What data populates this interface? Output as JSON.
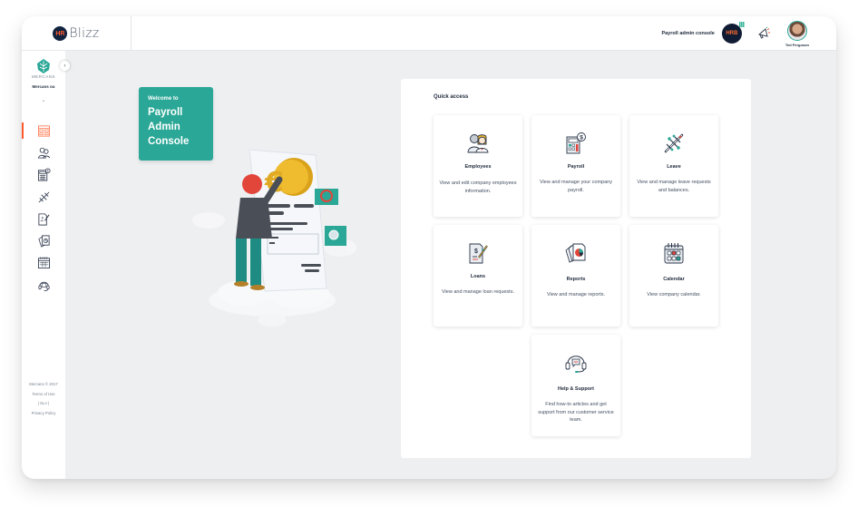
{
  "app": {
    "logo_badge": "HR",
    "name": "Blizz"
  },
  "header": {
    "console_label": "Payroll admin console",
    "company_logo_text": "HRB",
    "notifications_icon": "megaphone-icon",
    "user_name": "Ted Ferguson"
  },
  "sidebar": {
    "org_wordmark": "MERCANS",
    "org_name": "Mercans ou",
    "org_switch_icon": "chevron-down-icon",
    "collapse_icon": "chevron-right-icon",
    "items": [
      {
        "label": "Dashboard",
        "icon": "dashboard-icon",
        "active": true
      },
      {
        "label": "Employees",
        "icon": "employees-icon",
        "active": false
      },
      {
        "label": "Payroll",
        "icon": "payroll-calculator-icon",
        "active": false
      },
      {
        "label": "Leave",
        "icon": "airplane-icon",
        "active": false
      },
      {
        "label": "Loans",
        "icon": "loan-document-icon",
        "active": false
      },
      {
        "label": "Reports",
        "icon": "reports-icon",
        "active": false
      },
      {
        "label": "Calendar",
        "icon": "calendar-icon",
        "active": false
      },
      {
        "label": "Help & Support",
        "icon": "headset-icon",
        "active": false
      }
    ],
    "footer": {
      "copyright": "Mercans © 2017",
      "terms": "Terms of Use",
      "sla": "| SLA |",
      "privacy": "Privacy Policy"
    }
  },
  "welcome": {
    "small": "Welcome to",
    "title_line1": "Payroll",
    "title_line2": "Admin",
    "title_line3": "Console"
  },
  "quick_access": {
    "title": "Quick access",
    "tiles": [
      {
        "name": "Employees",
        "description": "View and edit company employees information.",
        "icon": "employees-icon"
      },
      {
        "name": "Payroll",
        "description": "View and manage your company payroll.",
        "icon": "payroll-calculator-icon"
      },
      {
        "name": "Leave",
        "description": "View and manage leave requests and balances.",
        "icon": "airplane-icon"
      },
      {
        "name": "Loans",
        "description": "View and manage loan requests.",
        "icon": "loan-document-icon"
      },
      {
        "name": "Reports",
        "description": "View and manage reports.",
        "icon": "reports-icon"
      },
      {
        "name": "Calendar",
        "description": "View company calendar.",
        "icon": "calendar-icon"
      },
      {
        "name": "Help & Support",
        "description": "Find how-to articles and get support from our customer service team.",
        "icon": "headset-icon"
      }
    ]
  },
  "colors": {
    "accent": "#ff5a2b",
    "teal": "#2aa796",
    "navy": "#12233f",
    "background": "#eeeff1"
  }
}
